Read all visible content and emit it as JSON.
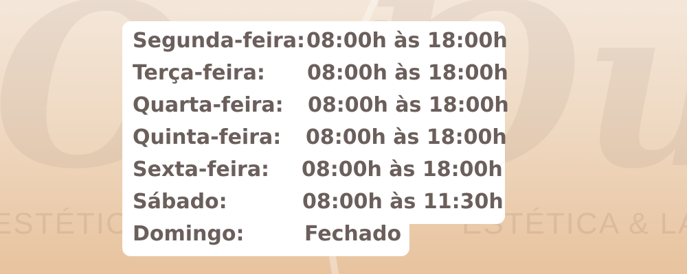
{
  "watermark": {
    "script_glyphs_left": "Ouk",
    "script_glyphs_right": "Ouse",
    "subtitle_left": "ESTÉTICA",
    "subtitle_right": "ESTÉTICA  & LAS"
  },
  "schedule": [
    {
      "day": "Segunda-feira:",
      "hours": "08:00h às 18:00h"
    },
    {
      "day": "Terça-feira:",
      "hours": "08:00h às 18:00h"
    },
    {
      "day": "Quarta-feira:",
      "hours": "08:00h às 18:00h"
    },
    {
      "day": "Quinta-feira:",
      "hours": "08:00h às 18:00h"
    },
    {
      "day": "Sexta-feira:",
      "hours": "08:00h às 18:00h"
    },
    {
      "day": "Sábado:",
      "hours": "08:00h às 11:30h"
    },
    {
      "day": "Domingo:",
      "hours": "Fechado"
    }
  ],
  "colors": {
    "text": "#6b5f5c",
    "card": "#ffffff",
    "background_top": "#f4e7da",
    "background_bottom": "#e8c39e"
  },
  "icons": {
    "watermark_leaf": "leaf-branch-icon"
  }
}
